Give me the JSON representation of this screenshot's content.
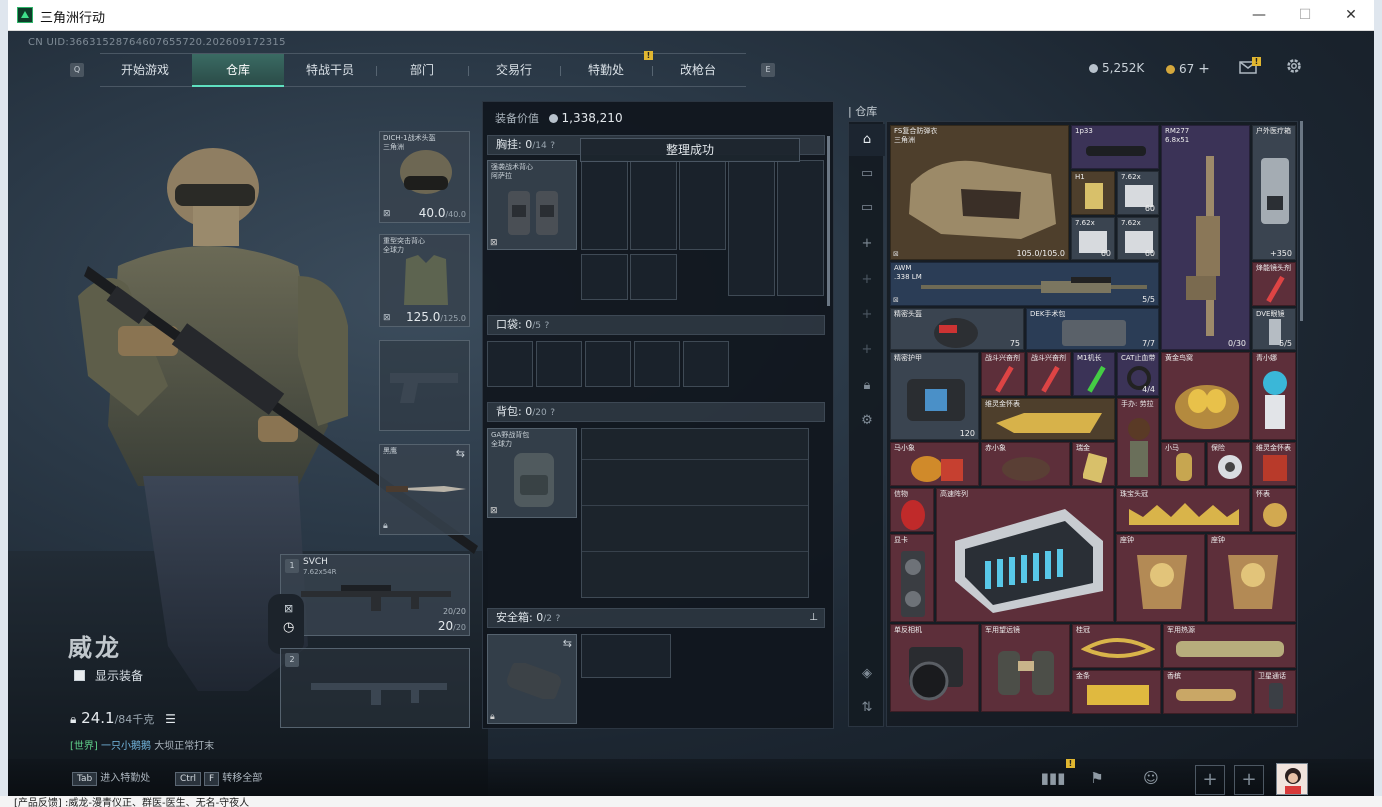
{
  "window": {
    "title": "三角洲行动",
    "min": "—",
    "max": "☐",
    "close": "✕"
  },
  "taskbar_text": "[产品反馈] :威龙-漫青仪正、群医-医生、无名-守夜人",
  "uid": "CN UID:36631528764607655720.202609172315",
  "nav": {
    "key_left": "Q",
    "key_right": "E",
    "tabs": [
      "开始游戏",
      "仓库",
      "特战干员",
      "部门",
      "交易行",
      "特勤处",
      "改枪台"
    ],
    "active": "仓库",
    "alert": "!"
  },
  "currency": {
    "silver": "5,252K",
    "gold": "67",
    "plus": "+"
  },
  "icons": {
    "mail": "mail-icon",
    "settings": "gear-icon"
  },
  "character": {
    "name": "威龙",
    "show_equipment": "显示装备",
    "weight": "24.1",
    "weight_max": "/84千克",
    "chat_channel": "[世界]",
    "chat_user": "一只小鹅鹅",
    "chat_msg": "大坝正常打末"
  },
  "hotkeys": {
    "tab_key": "Tab",
    "tab_label": "进入特勤处",
    "ctrl_key": "Ctrl",
    "f_key": "F",
    "ctrl_label": "转移全部"
  },
  "slots": {
    "helmet": {
      "name": "DICH-1战术头盔",
      "sub": "三角洲",
      "dur": "40.0",
      "max": "/40.0"
    },
    "armor": {
      "name": "重型突击背心",
      "sub": "全球力",
      "dur": "125.0",
      "max": "/125.0"
    },
    "melee": {
      "name": "黑鹰"
    },
    "primary": {
      "num": "1",
      "name": "SVCH",
      "ammo": "7.62x54R",
      "mag": "20/20",
      "count": "20",
      "count_max": "/20"
    },
    "secondary": {
      "num": "2"
    }
  },
  "mid": {
    "title": "装备价值",
    "value": "1,338,210",
    "chest": {
      "label": "胸挂:",
      "count": "0",
      "max": "/14",
      "item": "强袭战术背心",
      "item_sub": "阿萨拉"
    },
    "pocket": {
      "label": "口袋:",
      "count": "0",
      "max": "/5"
    },
    "backpack": {
      "label": "背包:",
      "count": "0",
      "max": "/20",
      "item": "GA野战背包",
      "item_sub": "全球力"
    },
    "safebox": {
      "label": "安全箱:",
      "count": "0",
      "max": "/2"
    },
    "help": "?",
    "toast": "整理成功"
  },
  "storage": {
    "label": "仓库",
    "items": [
      {
        "n": "FS复合防弹衣",
        "s": "三角洲",
        "v": "105.0/105.0"
      },
      {
        "n": "1p33",
        "v": ""
      },
      {
        "n": "RM277",
        "s": "6.8x51",
        "v": "0/30"
      },
      {
        "n": "户外医疗箱",
        "v": "+350"
      },
      {
        "n": "H1",
        "v": ""
      },
      {
        "n": "7.62x",
        "v": "60"
      },
      {
        "n": "7.62x",
        "v": "60"
      },
      {
        "n": "7.62x",
        "v": "60"
      },
      {
        "n": "AWM",
        "s": ".338 LM",
        "v": "5/5"
      },
      {
        "n": "烽能镜头剂",
        "v": ""
      },
      {
        "n": "精密头盔",
        "v": "75"
      },
      {
        "n": "DEK手术包",
        "v": "7/7"
      },
      {
        "n": "DVE眼镜",
        "v": "5/5"
      },
      {
        "n": "精密护甲",
        "v": "120"
      },
      {
        "n": "战斗兴奋剂",
        "v": ""
      },
      {
        "n": "战斗兴奋剂",
        "v": ""
      },
      {
        "n": "M1机长",
        "v": ""
      },
      {
        "n": "CAT止血带",
        "v": "4/4"
      },
      {
        "n": "黄金鸟窝",
        "v": ""
      },
      {
        "n": "青小娜",
        "v": ""
      },
      {
        "n": "维灵金怀表",
        "v": ""
      },
      {
        "n": "手办: 劳拉",
        "v": ""
      },
      {
        "n": "马小象",
        "v": ""
      },
      {
        "n": "赤小象",
        "v": ""
      },
      {
        "n": "瑞金",
        "v": ""
      },
      {
        "n": "小马",
        "v": ""
      },
      {
        "n": "保险",
        "v": ""
      },
      {
        "n": "信物",
        "v": ""
      },
      {
        "n": "高速阵列",
        "v": ""
      },
      {
        "n": "珠宝头冠",
        "v": ""
      },
      {
        "n": "怀表",
        "v": ""
      },
      {
        "n": "显卡",
        "v": ""
      },
      {
        "n": "座钟",
        "v": ""
      },
      {
        "n": "座钟",
        "v": ""
      },
      {
        "n": "单反相机",
        "v": ""
      },
      {
        "n": "军用望远镜",
        "v": ""
      },
      {
        "n": "桂冠",
        "v": ""
      },
      {
        "n": "军用热源",
        "v": ""
      },
      {
        "n": "金条",
        "v": ""
      },
      {
        "n": "香槟",
        "v": ""
      },
      {
        "n": "卫星通话",
        "v": ""
      }
    ]
  },
  "colors": {
    "accent": "#5fe0c0",
    "alert": "#e0b630"
  }
}
